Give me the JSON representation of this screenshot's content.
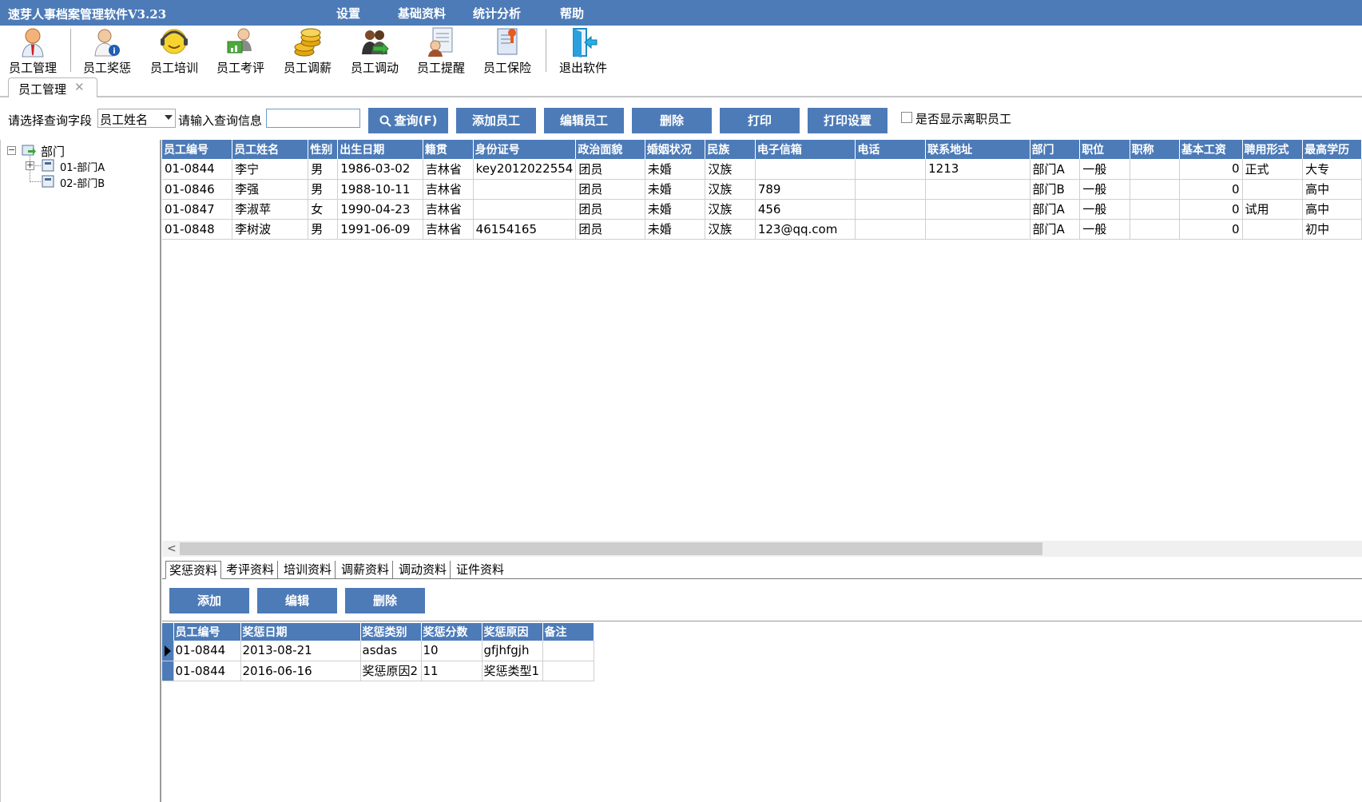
{
  "window": {
    "title": "速芽人事档案管理软件V3.23"
  },
  "menu": [
    "设置",
    "基础资料",
    "统计分析",
    "帮助"
  ],
  "toolbar": [
    {
      "label": "员工管理",
      "icon": "employee-manager-icon"
    },
    {
      "label": "员工奖惩",
      "icon": "employee-reward-icon"
    },
    {
      "label": "员工培训",
      "icon": "employee-training-icon"
    },
    {
      "label": "员工考评",
      "icon": "employee-evaluation-icon"
    },
    {
      "label": "员工调薪",
      "icon": "salary-coins-icon"
    },
    {
      "label": "员工调动",
      "icon": "employee-transfer-icon"
    },
    {
      "label": "员工提醒",
      "icon": "employee-reminder-icon"
    },
    {
      "label": "员工保险",
      "icon": "employee-insurance-icon"
    },
    {
      "label": "退出软件",
      "icon": "exit-door-icon"
    }
  ],
  "doc_tab": {
    "label": "员工管理",
    "close": "✕"
  },
  "search": {
    "field_label": "请选择查询字段",
    "field_value": "员工姓名",
    "info_label": "请输入查询信息",
    "query_value": "",
    "query_button": "查询(F)",
    "add_button": "添加员工",
    "edit_button": "编辑员工",
    "delete_button": "删除",
    "print_button": "打印",
    "print_settings_button": "打印设置",
    "show_resigned_label": "是否显示离职员工",
    "show_resigned_checked": false
  },
  "tree": {
    "root": "部门",
    "children": [
      "01-部门A",
      "02-部门B"
    ]
  },
  "grid": {
    "columns": [
      "员工编号",
      "员工姓名",
      "性别",
      "出生日期",
      "籍贯",
      "身份证号",
      "政治面貌",
      "婚姻状况",
      "民族",
      "电子信箱",
      "电话",
      "联系地址",
      "部门",
      "职位",
      "职称",
      "基本工资",
      "聘用形式",
      "最高学历"
    ],
    "rows": [
      [
        "01-0844",
        "李宁",
        "男",
        "1986-03-02",
        "吉林省",
        "key2012022554",
        "团员",
        "未婚",
        "汉族",
        "",
        "",
        "1213",
        "部门A",
        "一般",
        "",
        "0",
        "正式",
        "大专"
      ],
      [
        "01-0846",
        "李强",
        "男",
        "1988-10-11",
        "吉林省",
        "",
        "团员",
        "未婚",
        "汉族",
        "789",
        "",
        "",
        "部门B",
        "一般",
        "",
        "0",
        "",
        "高中"
      ],
      [
        "01-0847",
        "李淑苹",
        "女",
        "1990-04-23",
        "吉林省",
        "",
        "团员",
        "未婚",
        "汉族",
        "456",
        "",
        "",
        "部门A",
        "一般",
        "",
        "0",
        "试用",
        "高中"
      ],
      [
        "01-0848",
        "李树波",
        "男",
        "1991-06-09",
        "吉林省",
        "46154165",
        "团员",
        "未婚",
        "汉族",
        "123@qq.com",
        "",
        "",
        "部门A",
        "一般",
        "",
        "0",
        "",
        "初中"
      ]
    ]
  },
  "sub_tabs": [
    "奖惩资料",
    "考评资料",
    "培训资料",
    "调薪资料",
    "调动资料",
    "证件资料"
  ],
  "sub_buttons": {
    "add": "添加",
    "edit": "编辑",
    "delete": "删除"
  },
  "subgrid": {
    "columns": [
      "员工编号",
      "奖惩日期",
      "奖惩类别",
      "奖惩分数",
      "奖惩原因",
      "备注"
    ],
    "rows": [
      [
        "01-0844",
        "2013-08-21",
        "asdas",
        "10",
        "gfjhfgjh",
        ""
      ],
      [
        "01-0844",
        "2016-06-16",
        "奖惩原因2",
        "11",
        "奖惩类型1",
        ""
      ]
    ]
  },
  "colors": {
    "accent": "#4d7bb8",
    "header_text": "#ffffff"
  }
}
